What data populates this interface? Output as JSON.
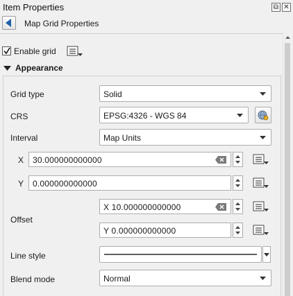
{
  "window": {
    "title": "Item Properties",
    "float_glyph": "⧉",
    "close_glyph": "✕"
  },
  "header": {
    "title": "Map Grid Properties"
  },
  "enable_grid": {
    "label": "Enable grid",
    "checked": true
  },
  "appearance": {
    "section_label": "Appearance",
    "grid_type": {
      "label": "Grid type",
      "value": "Solid"
    },
    "crs": {
      "label": "CRS",
      "value": "EPSG:4326 - WGS 84"
    },
    "interval": {
      "label": "Interval",
      "units": "Map Units",
      "x_label": "X",
      "x_value": "30.000000000000",
      "y_label": "Y",
      "y_value": "0.000000000000"
    },
    "offset": {
      "label": "Offset",
      "x_value": "X 10.000000000000",
      "y_value": "Y 0.000000000000"
    },
    "line_style": {
      "label": "Line style"
    },
    "blend_mode": {
      "label": "Blend mode",
      "value": "Normal"
    }
  },
  "colors": {
    "background": "#f0f0f0",
    "field_border": "#adadad",
    "accent": "#1f5fa8"
  }
}
